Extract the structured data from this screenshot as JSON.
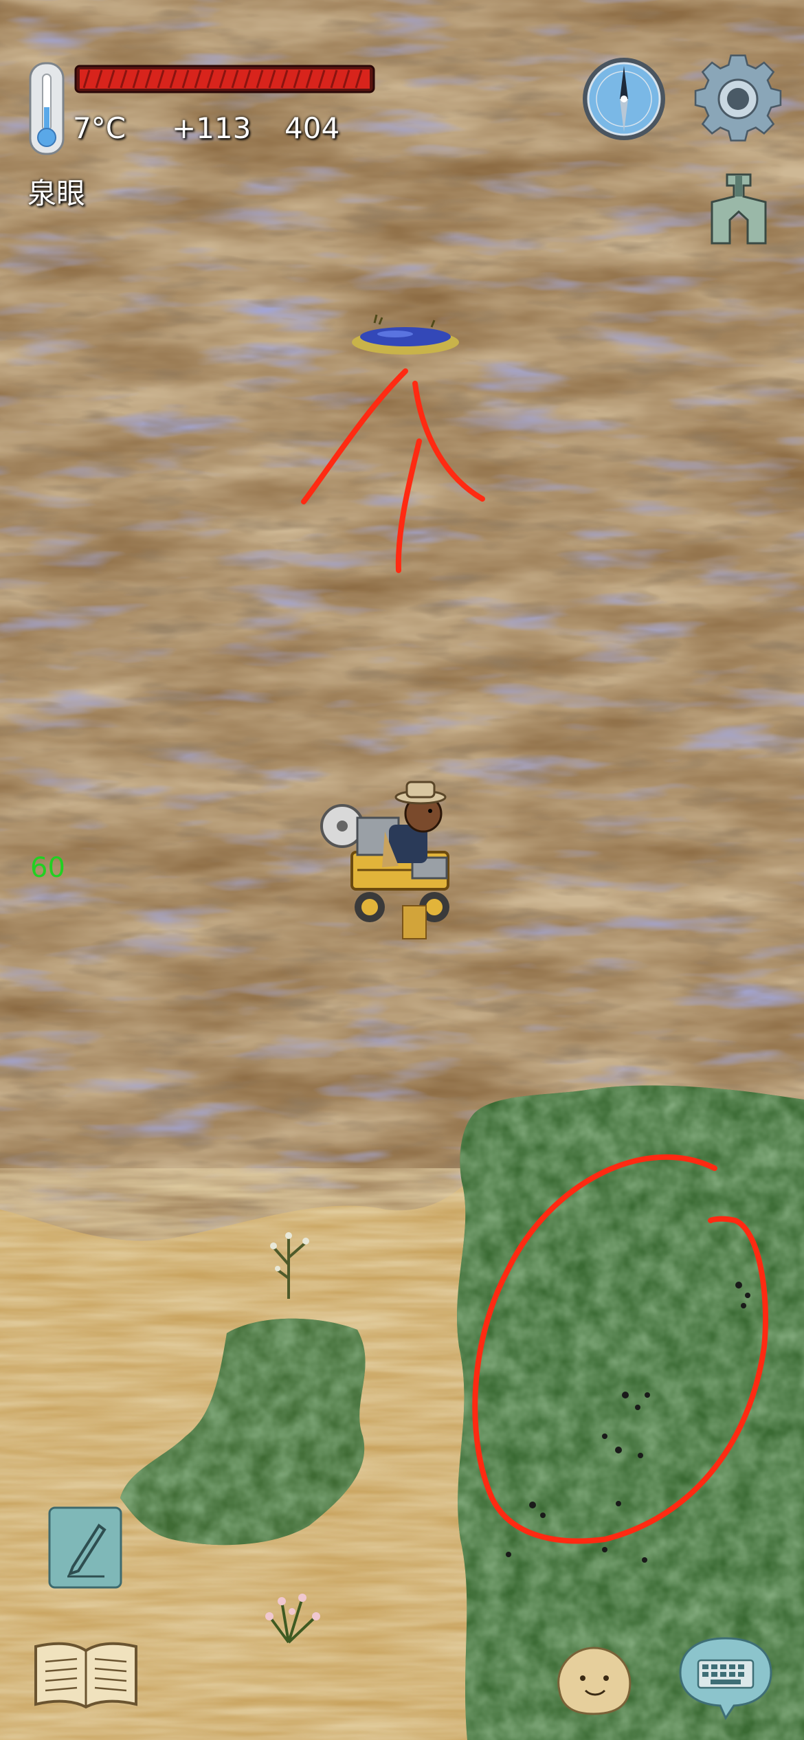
{
  "hud": {
    "temperature": "7°C",
    "food_bonus": "+113",
    "score": "404",
    "location_name": "泉眼",
    "fps": "60",
    "health_fill_fraction": 1.0
  },
  "icons": {
    "thermometer": "thermometer-icon",
    "compass": "compass-icon",
    "settings": "gear-icon",
    "tech_tree": "tech-tree-icon",
    "note": "pencil-icon",
    "recipe_book": "open-book-icon",
    "emote": "smiley-face-icon",
    "chat": "keyboard-icon"
  },
  "colors": {
    "health_red": "#d8241c",
    "annotation_red": "#ff2a12",
    "fps_green": "#22d022",
    "button_teal": "#7fb8b8"
  }
}
